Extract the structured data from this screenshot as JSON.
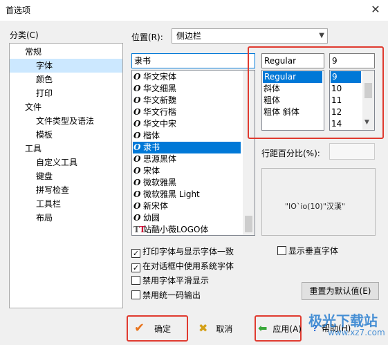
{
  "window": {
    "title": "首选项",
    "close_glyph": "✕"
  },
  "left": {
    "category_label": "分类(C)",
    "tree": [
      {
        "label": "常规",
        "level": 0,
        "selected": false
      },
      {
        "label": "字体",
        "level": 1,
        "selected": true
      },
      {
        "label": "颜色",
        "level": 1,
        "selected": false
      },
      {
        "label": "打印",
        "level": 1,
        "selected": false
      },
      {
        "label": "文件",
        "level": 0,
        "selected": false
      },
      {
        "label": "文件类型及语法",
        "level": 1,
        "selected": false
      },
      {
        "label": "模板",
        "level": 1,
        "selected": false
      },
      {
        "label": "工具",
        "level": 0,
        "selected": false
      },
      {
        "label": "自定义工具",
        "level": 1,
        "selected": false
      },
      {
        "label": "键盘",
        "level": 1,
        "selected": false
      },
      {
        "label": "拼写检查",
        "level": 1,
        "selected": false
      },
      {
        "label": "工具栏",
        "level": 1,
        "selected": false
      },
      {
        "label": "布局",
        "level": 1,
        "selected": false
      }
    ]
  },
  "position": {
    "label": "位置(R):",
    "value": "侧边栏"
  },
  "font": {
    "current": "隶书",
    "list": [
      {
        "label": "华文宋体",
        "icon": "O",
        "selected": false
      },
      {
        "label": "华文细黑",
        "icon": "O",
        "selected": false
      },
      {
        "label": "华文新魏",
        "icon": "O",
        "selected": false
      },
      {
        "label": "华文行楷",
        "icon": "O",
        "selected": false
      },
      {
        "label": "华文中宋",
        "icon": "O",
        "selected": false
      },
      {
        "label": "楷体",
        "icon": "O",
        "selected": false
      },
      {
        "label": "隶书",
        "icon": "O",
        "selected": true
      },
      {
        "label": "思源黑体",
        "icon": "O",
        "selected": false
      },
      {
        "label": "宋体",
        "icon": "O",
        "selected": false
      },
      {
        "label": "微软雅黑",
        "icon": "O",
        "selected": false
      },
      {
        "label": "微软雅黑 Light",
        "icon": "O",
        "selected": false
      },
      {
        "label": "新宋体",
        "icon": "O",
        "selected": false
      },
      {
        "label": "幼圆",
        "icon": "O",
        "selected": false
      },
      {
        "label": "站酷小薇LOGO体",
        "icon": "TT",
        "selected": false
      }
    ]
  },
  "style": {
    "current": "Regular",
    "list": [
      {
        "label": "Regular",
        "selected": true
      },
      {
        "label": "斜体",
        "selected": false
      },
      {
        "label": "粗体",
        "selected": false
      },
      {
        "label": "粗体 斜体",
        "selected": false
      }
    ]
  },
  "size": {
    "current": "9",
    "list": [
      {
        "label": "9",
        "selected": true
      },
      {
        "label": "10",
        "selected": false
      },
      {
        "label": "11",
        "selected": false
      },
      {
        "label": "12",
        "selected": false
      },
      {
        "label": "14",
        "selected": false
      }
    ]
  },
  "line_spacing": {
    "label": "行距百分比(%):",
    "value": ""
  },
  "preview": {
    "text": "\"IO`io(10)\"汉漢\""
  },
  "options": {
    "print_match": {
      "label": "打印字体与显示字体一致",
      "checked": true
    },
    "use_system_font": {
      "label": "在对话框中使用系统字体",
      "checked": true
    },
    "disable_smoothing": {
      "label": "禁用字体平滑显示",
      "checked": false
    },
    "disable_unicode": {
      "label": "禁用统一码输出",
      "checked": false
    },
    "vertical_font": {
      "label": "显示垂直字体",
      "checked": false
    }
  },
  "buttons": {
    "reset": "重置为默认值(E)",
    "ok": "确定",
    "cancel": "取消",
    "apply": "应用(A)",
    "help": "帮助(H)"
  },
  "watermark": {
    "text1": "极光下载站",
    "text2": "www.xz7.com"
  },
  "colors": {
    "highlight": "#0078d7",
    "tree_selected": "#cce8ff",
    "annotation_red": "#e03a2f"
  }
}
